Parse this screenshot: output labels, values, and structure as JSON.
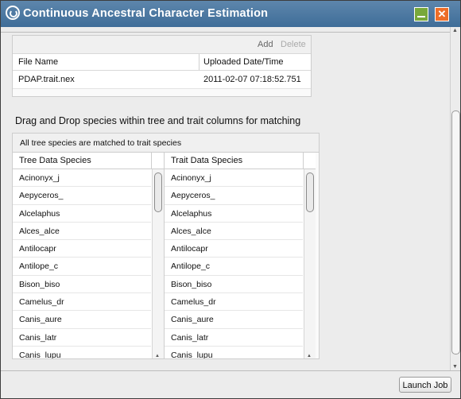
{
  "window": {
    "title": "Continuous Ancestral Character Estimation",
    "minimize_icon": "minimize-icon",
    "close_icon": "close-icon",
    "close_glyph": "✕",
    "accent": "#4a77a2"
  },
  "file_panel": {
    "add_label": "Add",
    "delete_label": "Delete",
    "columns": [
      "File Name",
      "Uploaded Date/Time"
    ],
    "rows": [
      {
        "name": "PDAP.trait.nex",
        "date": "2011-02-07 07:18:52.751"
      }
    ]
  },
  "instructions": "Drag and Drop species within tree and trait columns for matching",
  "match_panel": {
    "status": "All tree species are matched to trait species",
    "tree_column_header": "Tree Data Species",
    "trait_column_header": "Trait Data Species",
    "tree_species": [
      "Acinonyx_j",
      "Aepyceros_",
      "Alcelaphus",
      "Alces_alce",
      "Antilocapr",
      "Antilope_c",
      "Bison_biso",
      "Camelus_dr",
      "Canis_aure",
      "Canis_latr",
      "Canis_lupu"
    ],
    "trait_species": [
      "Acinonyx_j",
      "Aepyceros_",
      "Alcelaphus",
      "Alces_alce",
      "Antilocapr",
      "Antilope_c",
      "Bison_biso",
      "Camelus_dr",
      "Canis_aure",
      "Canis_latr",
      "Canis_lupu"
    ]
  },
  "footer": {
    "launch_label": "Launch Job"
  }
}
